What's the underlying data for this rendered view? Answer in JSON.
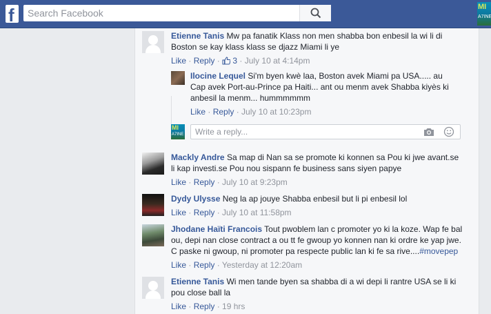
{
  "header": {
    "logo_letter": "f",
    "search_placeholder": "Search Facebook",
    "corner_avatar_text": "MI",
    "corner_avatar_sub": "A7INE"
  },
  "comments": [
    {
      "name": "Etienne Tanis",
      "text_line1": "Mw pa fanatik Klass non men shabba bon enbesil la wi li di",
      "text_line2": "Boston se kay klass klass se djazz Miami li ye",
      "like": "Like",
      "reply": "Reply",
      "likes_count": "3",
      "time": "July 10 at 4:14pm"
    },
    {
      "name": "Ilocine Lequel",
      "text_line1": "Si'm byen kwè laa, Boston avek Miami pa USA..... au",
      "text_line2": "Cap avek Port-au-Prince pa Haiti... ant ou menm avek Shabba kiyès ki",
      "text_line3": "anbesil la menm... hummmmmm",
      "like": "Like",
      "reply": "Reply",
      "time": "July 10 at 10:23pm"
    },
    {
      "name": "Mackly Andre",
      "text_line1": "Sa map di Nan sa se promote ki konnen sa Pou ki jwe avant.se",
      "text_line2": "li kap investi.se Pou nou sispann fe business sans siyen papye",
      "like": "Like",
      "reply": "Reply",
      "time": "July 10 at 9:23pm"
    },
    {
      "name": "Dydy Ulysse",
      "text_line1": "Neg la ap jouye Shabba enbesil but li pi enbesil lol",
      "like": "Like",
      "reply": "Reply",
      "time": "July 10 at 11:58pm"
    },
    {
      "name": "Jhodane Haïti Francois",
      "text_line1": "Tout pwoblem lan c promoter yo ki la koze. Wap fe bal",
      "text_line2": "ou, depi nan close contract a ou tt fe gwoup yo konnen nan ki ordre ke yap jwe.",
      "text_line3": "C paske ni gwoup, ni promoter pa respecte public lan ki fe sa rive....",
      "hashtag": "#movepep",
      "like": "Like",
      "reply": "Reply",
      "time": "Yesterday at 12:20am"
    },
    {
      "name": "Etienne Tanis",
      "text_line1": "Wi men tande byen sa shabba di a wi depi li rantre USA se li ki",
      "text_line2": "pou close ball la",
      "like": "Like",
      "reply": "Reply",
      "time": "19 hrs"
    }
  ],
  "reply_box": {
    "placeholder": "Write a reply...",
    "avatar_text": "MI",
    "avatar_sub": "A7INE"
  },
  "separator": "·"
}
